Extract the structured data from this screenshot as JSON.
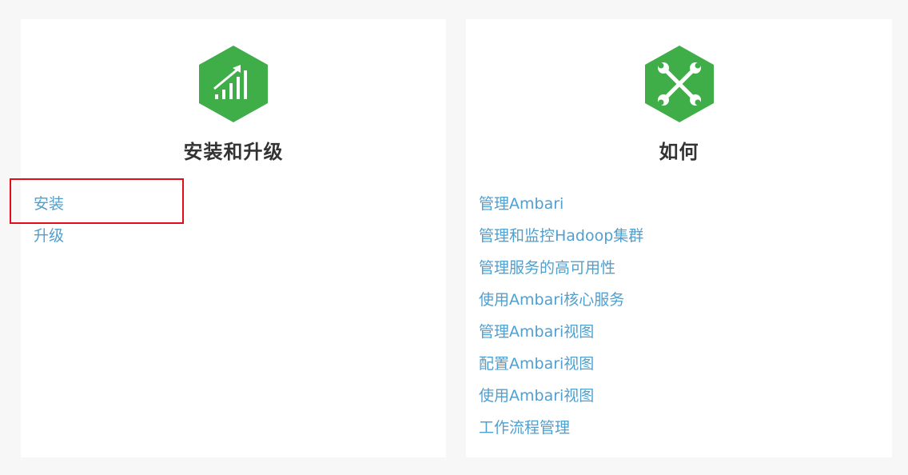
{
  "cards": [
    {
      "title": "安装和升级",
      "icon": "chart-growth-icon",
      "links": [
        "安装",
        "升级"
      ]
    },
    {
      "title": "如何",
      "icon": "wrench-tools-icon",
      "links": [
        "管理Ambari",
        "管理和监控Hadoop集群",
        "管理服务的高可用性",
        "使用Ambari核心服务",
        "管理Ambari视图",
        "配置Ambari视图",
        "使用Ambari视图",
        "工作流程管理"
      ]
    }
  ],
  "colors": {
    "icon_green": "#3fae49",
    "link_blue": "#4f9fcf",
    "highlight_red": "#e10d18"
  }
}
